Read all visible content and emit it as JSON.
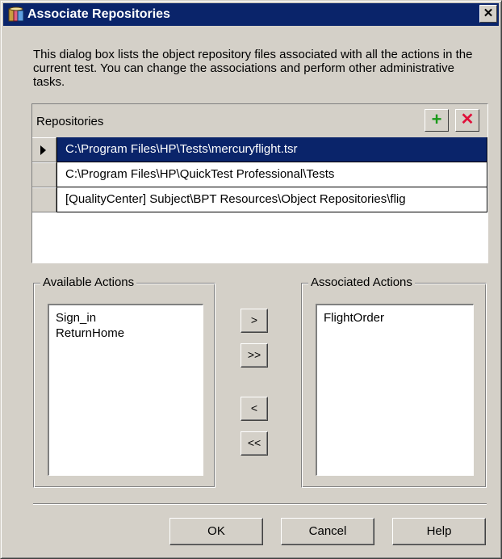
{
  "dialog": {
    "title": "Associate Repositories",
    "close_label": "✕",
    "description": "This dialog box lists the object repository files associated with all the actions in the current test. You can change the associations and perform other administrative tasks."
  },
  "repositories": {
    "header": "Repositories",
    "add_label": "+",
    "remove_label": "✕",
    "rows": [
      {
        "path": "C:\\Program Files\\HP\\Tests\\mercuryflight.tsr",
        "selected": true
      },
      {
        "path": "C:\\Program Files\\HP\\QuickTest Professional\\Tests",
        "selected": false
      },
      {
        "path": "[QualityCenter] Subject\\BPT Resources\\Object Repositories\\flig",
        "selected": false
      }
    ]
  },
  "available_actions": {
    "label": "Available Actions",
    "items": [
      "Sign_in",
      "ReturnHome"
    ]
  },
  "associated_actions": {
    "label": "Associated Actions",
    "items": [
      "FlightOrder"
    ]
  },
  "move_buttons": {
    "add_one": ">",
    "add_all": ">>",
    "remove_one": "<",
    "remove_all": "<<"
  },
  "footer": {
    "ok": "OK",
    "cancel": "Cancel",
    "help": "Help"
  },
  "colors": {
    "title_bar": "#0a246a",
    "selection": "#0a246a",
    "dialog_face": "#d4d0c8",
    "add_icon": "#1a9a1a",
    "remove_icon": "#e0103a"
  }
}
